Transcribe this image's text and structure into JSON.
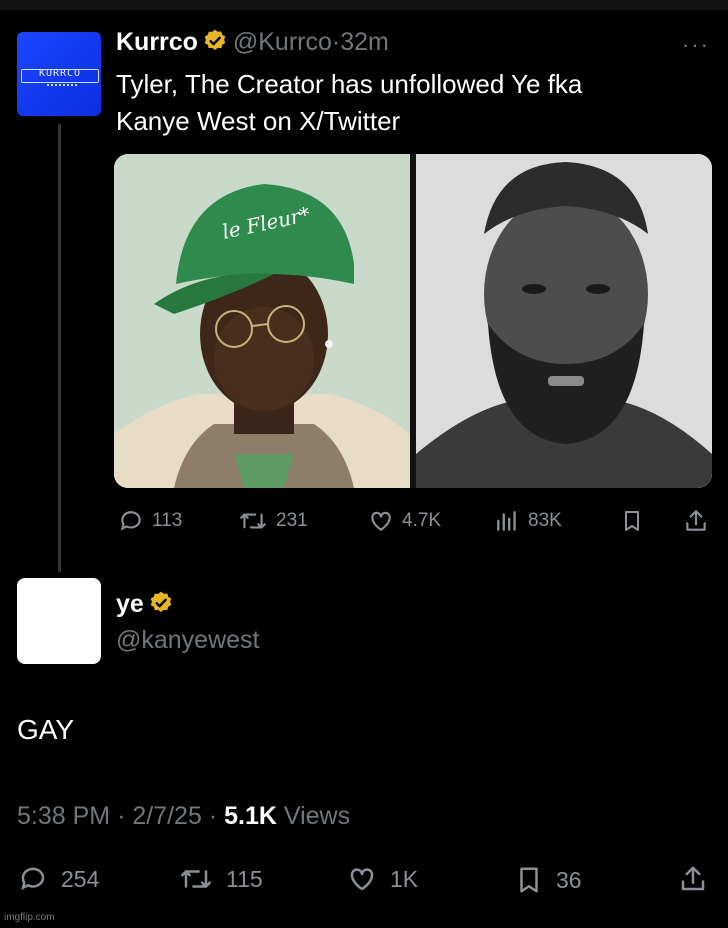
{
  "tweet1": {
    "display_name": "Kurrco",
    "handle": "@Kurrco",
    "separator": "·",
    "time": "32m",
    "text_line1": "Tyler, The Creator has unfollowed Ye fka",
    "text_line2": "Kanye West on X/Twitter",
    "more_label": "···",
    "avatar_text": "KURRCO",
    "actions": {
      "replies": "113",
      "reposts": "231",
      "likes": "4.7K",
      "views": "83K"
    }
  },
  "tweet2": {
    "display_name": "ye",
    "handle": "@kanyewest",
    "text": "GAY",
    "meta": {
      "time": "5:38 PM",
      "sep1": "·",
      "date": "2/7/25",
      "sep2": "·",
      "views_count": "5.1K",
      "views_label": "Views"
    },
    "stats": {
      "replies": "254",
      "reposts": "115",
      "likes": "1K",
      "bookmarks": "36"
    }
  },
  "watermark": "imgflip.com",
  "colors": {
    "background": "#000000",
    "text_primary": "#ffffff",
    "text_secondary": "#71767b",
    "verified_gold": "#e8b52a",
    "avatar_blue": "#1a46ff"
  }
}
